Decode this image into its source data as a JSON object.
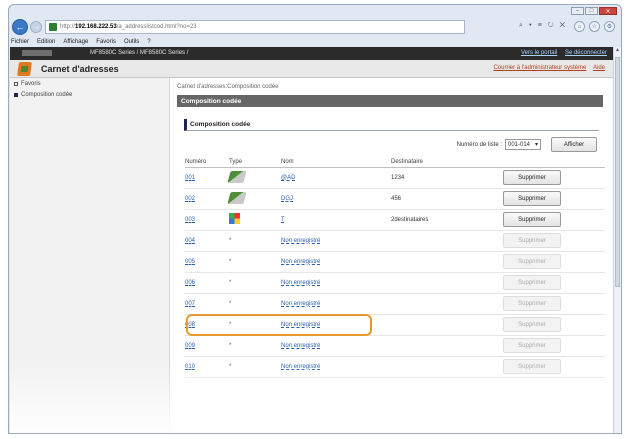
{
  "browser": {
    "url_prefix": "http://",
    "url_host": "192.168.222.53",
    "url_path": "/a_addresslistcod.html?no=23",
    "address_tools": "⌕ ▾ ≡ ↻ ✕",
    "menus": [
      "Fichier",
      "Edition",
      "Affichage",
      "Favoris",
      "Outils",
      "?"
    ]
  },
  "topbar": {
    "model": "MF8580C Series / MF8580C Series /",
    "link_portal": "Vers le portail",
    "link_logout": "Se déconnecter"
  },
  "app": {
    "title": "Carnet d'adresses",
    "link_mail": "Courrier à l'administrateur système",
    "link_help": "Aide"
  },
  "sidebar": {
    "items": [
      {
        "label": "Favoris",
        "active": false
      },
      {
        "label": "Composition codée",
        "active": true
      }
    ]
  },
  "main": {
    "breadcrumb": "Carnet d'adresses:Composition codée",
    "section_title": "Composition codée",
    "subheading": "Composition codée",
    "list_number_label": "Numéro de liste :",
    "list_number_value": "001-014",
    "show_button": "Afficher",
    "columns": [
      "Numéro",
      "Type",
      "Nom",
      "Destinataire",
      ""
    ],
    "delete_label": "Supprimer",
    "rows": [
      {
        "number": "001",
        "type": "fax-icon",
        "name": "@AD",
        "destination": "1234",
        "enabled": true
      },
      {
        "number": "002",
        "type": "fax-icon",
        "name": "DGJ",
        "destination": "456",
        "enabled": true
      },
      {
        "number": "003",
        "type": "group-icon",
        "name": "T",
        "destination": "2destinataires",
        "enabled": true
      },
      {
        "number": "004",
        "type": "empty",
        "name": "Non enregistré",
        "destination": "",
        "enabled": false
      },
      {
        "number": "005",
        "type": "empty",
        "name": "Non enregistré",
        "destination": "",
        "enabled": false
      },
      {
        "number": "006",
        "type": "empty",
        "name": "Non enregistré",
        "destination": "",
        "enabled": false
      },
      {
        "number": "007",
        "type": "empty",
        "name": "Non enregistré",
        "destination": "",
        "enabled": false
      },
      {
        "number": "008",
        "type": "empty",
        "name": "Non enregistré",
        "destination": "",
        "enabled": false
      },
      {
        "number": "009",
        "type": "empty",
        "name": "Non enregistré",
        "destination": "",
        "enabled": false
      },
      {
        "number": "010",
        "type": "empty",
        "name": "Non enregistré",
        "destination": "",
        "enabled": false
      }
    ],
    "empty_type_symbol": "*"
  },
  "colors": {
    "accent_highlight": "#e59a2e",
    "link": "#2a5db0",
    "topbar_bg": "#2b2b2b"
  }
}
